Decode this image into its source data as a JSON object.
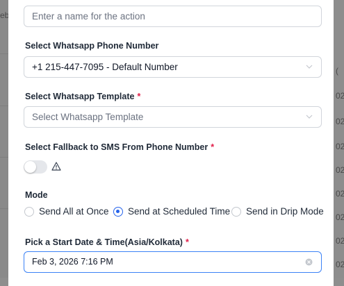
{
  "background": {
    "left_fragment": "eb",
    "right_fragments": [
      "(",
      "02",
      "02",
      "02",
      "02",
      "02",
      "02",
      "02",
      "02"
    ]
  },
  "form": {
    "action_name": {
      "placeholder": "Enter a name for the action",
      "value": ""
    },
    "phone_number": {
      "label": "Select Whatsapp Phone Number",
      "value": "+1 215-447-7095 - Default Number"
    },
    "template": {
      "label": "Select Whatsapp Template",
      "required_mark": "*",
      "placeholder": "Select Whatsapp Template"
    },
    "fallback": {
      "label": "Select Fallback to SMS From Phone Number",
      "required_mark": "*",
      "toggle_on": false,
      "warning_icon": "warning-triangle-icon"
    },
    "mode": {
      "label": "Mode",
      "options": [
        {
          "label": "Send All at Once",
          "selected": false
        },
        {
          "label": "Send at Scheduled Time",
          "selected": true
        },
        {
          "label": "Send in Drip Mode",
          "selected": false
        }
      ]
    },
    "start_datetime": {
      "label": "Pick a Start Date & Time(Asia/Kolkata)",
      "required_mark": "*",
      "value": "Feb 3, 2026 7:16 PM"
    }
  },
  "colors": {
    "accent": "#2563eb",
    "required": "#e11d48",
    "overlay": "#8e8e8e"
  }
}
